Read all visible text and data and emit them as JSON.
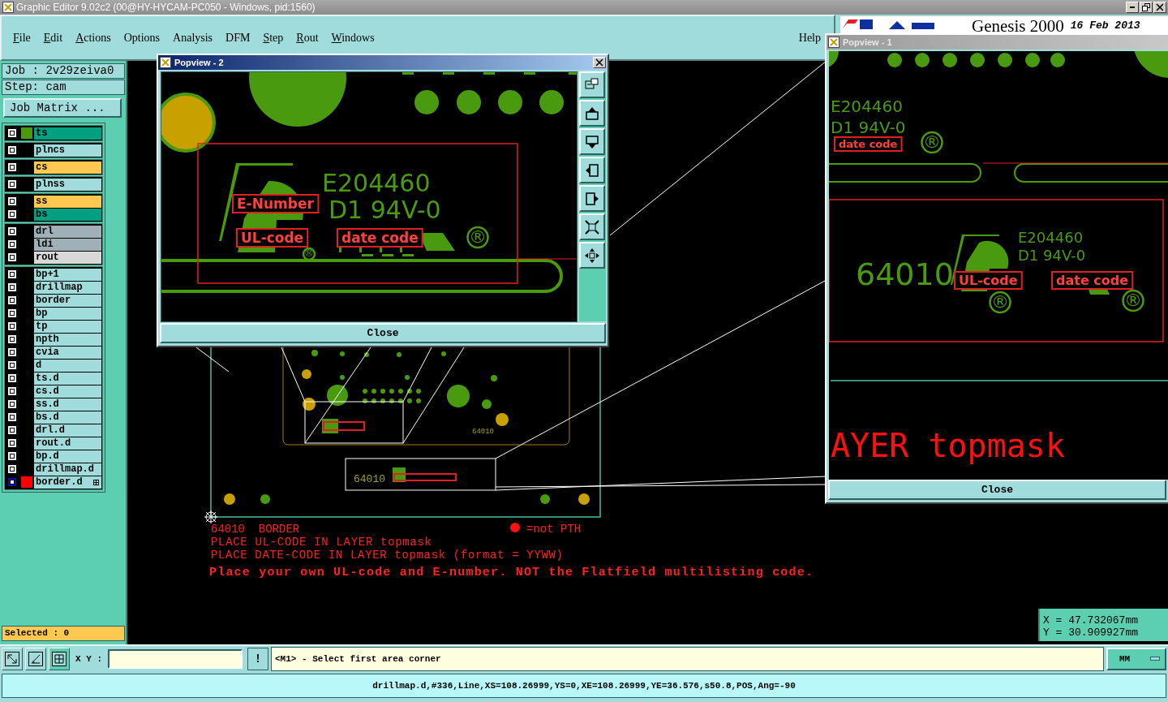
{
  "window": {
    "title": "Graphic Editor 9.02c2 (00@HY-HYCAM-PC050 - Windows, pid:1560)"
  },
  "menu": [
    {
      "label": "File",
      "mnemonic": true
    },
    {
      "label": "Edit",
      "mnemonic": true
    },
    {
      "label": "Actions",
      "mnemonic": true
    },
    {
      "label": "Options",
      "mnemonic": false
    },
    {
      "label": "Analysis",
      "mnemonic": false
    },
    {
      "label": "DFM",
      "mnemonic": false
    },
    {
      "label": "Step",
      "mnemonic": true
    },
    {
      "label": "Rout",
      "mnemonic": true
    },
    {
      "label": "Windows",
      "mnemonic": true
    }
  ],
  "help": {
    "label": "Help",
    "mnemonic": false
  },
  "logo": {
    "product": "Genesis 2000",
    "date": "16 Feb 2013"
  },
  "job": {
    "job": "Job : 2v29zeiva0",
    "step": "Step: cam",
    "matrix_button": "Job Matrix ..."
  },
  "layer_groups": [
    [
      {
        "name": "ts",
        "kind": "silk",
        "color": "#4a9a10",
        "selected": false
      }
    ],
    [
      {
        "name": "plncs",
        "kind": "misc",
        "selected": false
      }
    ],
    [
      {
        "name": "cs",
        "kind": "mask",
        "selected": false
      }
    ],
    [
      {
        "name": "plnss",
        "kind": "misc",
        "selected": false
      }
    ],
    [
      {
        "name": "ss",
        "kind": "mask",
        "selected": false
      },
      {
        "name": "bs",
        "kind": "silk",
        "selected": false
      }
    ],
    [
      {
        "name": "drl",
        "kind": "drill",
        "selected": false
      },
      {
        "name": "ldi",
        "kind": "drill",
        "selected": false
      },
      {
        "name": "rout",
        "kind": "rout",
        "selected": false
      }
    ],
    [
      {
        "name": "bp+1",
        "kind": "misc",
        "selected": false
      },
      {
        "name": "drillmap",
        "kind": "misc",
        "selected": false
      },
      {
        "name": "border",
        "kind": "misc",
        "selected": false
      },
      {
        "name": "bp",
        "kind": "misc",
        "selected": false
      },
      {
        "name": "tp",
        "kind": "misc",
        "selected": false
      },
      {
        "name": "npth",
        "kind": "misc",
        "selected": false
      },
      {
        "name": "cvia",
        "kind": "misc",
        "selected": false
      },
      {
        "name": "d",
        "kind": "misc",
        "selected": false
      },
      {
        "name": "ts.d",
        "kind": "misc",
        "selected": false
      },
      {
        "name": "cs.d",
        "kind": "misc",
        "selected": false
      },
      {
        "name": "ss.d",
        "kind": "misc",
        "selected": false
      },
      {
        "name": "bs.d",
        "kind": "misc",
        "selected": false
      },
      {
        "name": "drl.d",
        "kind": "misc",
        "selected": false
      },
      {
        "name": "rout.d",
        "kind": "misc",
        "selected": false
      },
      {
        "name": "bp.d",
        "kind": "misc",
        "selected": false
      },
      {
        "name": "drillmap.d",
        "kind": "misc",
        "selected": false
      },
      {
        "name": "border.d",
        "kind": "misc",
        "color": "#ff0000",
        "selected": true
      }
    ]
  ],
  "selected_count": "Selected : 0",
  "canvas": {
    "notes": [
      "64010  BORDER",
      "=not PTH",
      "PLACE UL-CODE IN LAYER topmask",
      "PLACE DATE-CODE IN LAYER topmask (format = YYWW)",
      "Place your own UL-code and E-number. NOT the Flatfield multilisting code."
    ],
    "labels": [
      "64010",
      "64010"
    ]
  },
  "popviews": [
    {
      "title": "Popview - 2",
      "active": true,
      "close": "Close",
      "texts": [
        {
          "text": "E204460",
          "kind": "silk"
        },
        {
          "text": "E-Number",
          "kind": "mark"
        },
        {
          "text": "D1 94V-0",
          "kind": "silk"
        },
        {
          "text": "UL-code",
          "kind": "mark"
        },
        {
          "text": "®",
          "kind": "silk"
        },
        {
          "text": "date code",
          "kind": "mark"
        },
        {
          "text": "®",
          "kind": "silk"
        }
      ]
    },
    {
      "title": "Popview - 1",
      "active": false,
      "close": "Close",
      "texts": [
        {
          "text": "E204460",
          "kind": "silk"
        },
        {
          "text": "D1 94V-0",
          "kind": "silk"
        },
        {
          "text": "date code",
          "kind": "mark"
        },
        {
          "text": "®",
          "kind": "silk"
        },
        {
          "text": "E204460",
          "kind": "silk"
        },
        {
          "text": "64010",
          "kind": "silk"
        },
        {
          "text": "D1 94V-0",
          "kind": "silk"
        },
        {
          "text": "UL-code",
          "kind": "mark"
        },
        {
          "text": "date code",
          "kind": "mark"
        },
        {
          "text": "®",
          "kind": "silk"
        },
        {
          "text": "®",
          "kind": "silk"
        },
        {
          "text": "AYER topmask",
          "kind": "note"
        }
      ]
    }
  ],
  "coords": {
    "x": "X = 47.732067mm",
    "y": "Y = 30.909927mm"
  },
  "command": {
    "xy_label": "X Y :",
    "alert": "!",
    "prompt": "<M1> - Select first area corner",
    "units": "MM"
  },
  "status": "drillmap.d,#336,Line,XS=108.26999,YS=0,XE=108.26999,YE=36.576,s50.8,POS,Ang=-90"
}
